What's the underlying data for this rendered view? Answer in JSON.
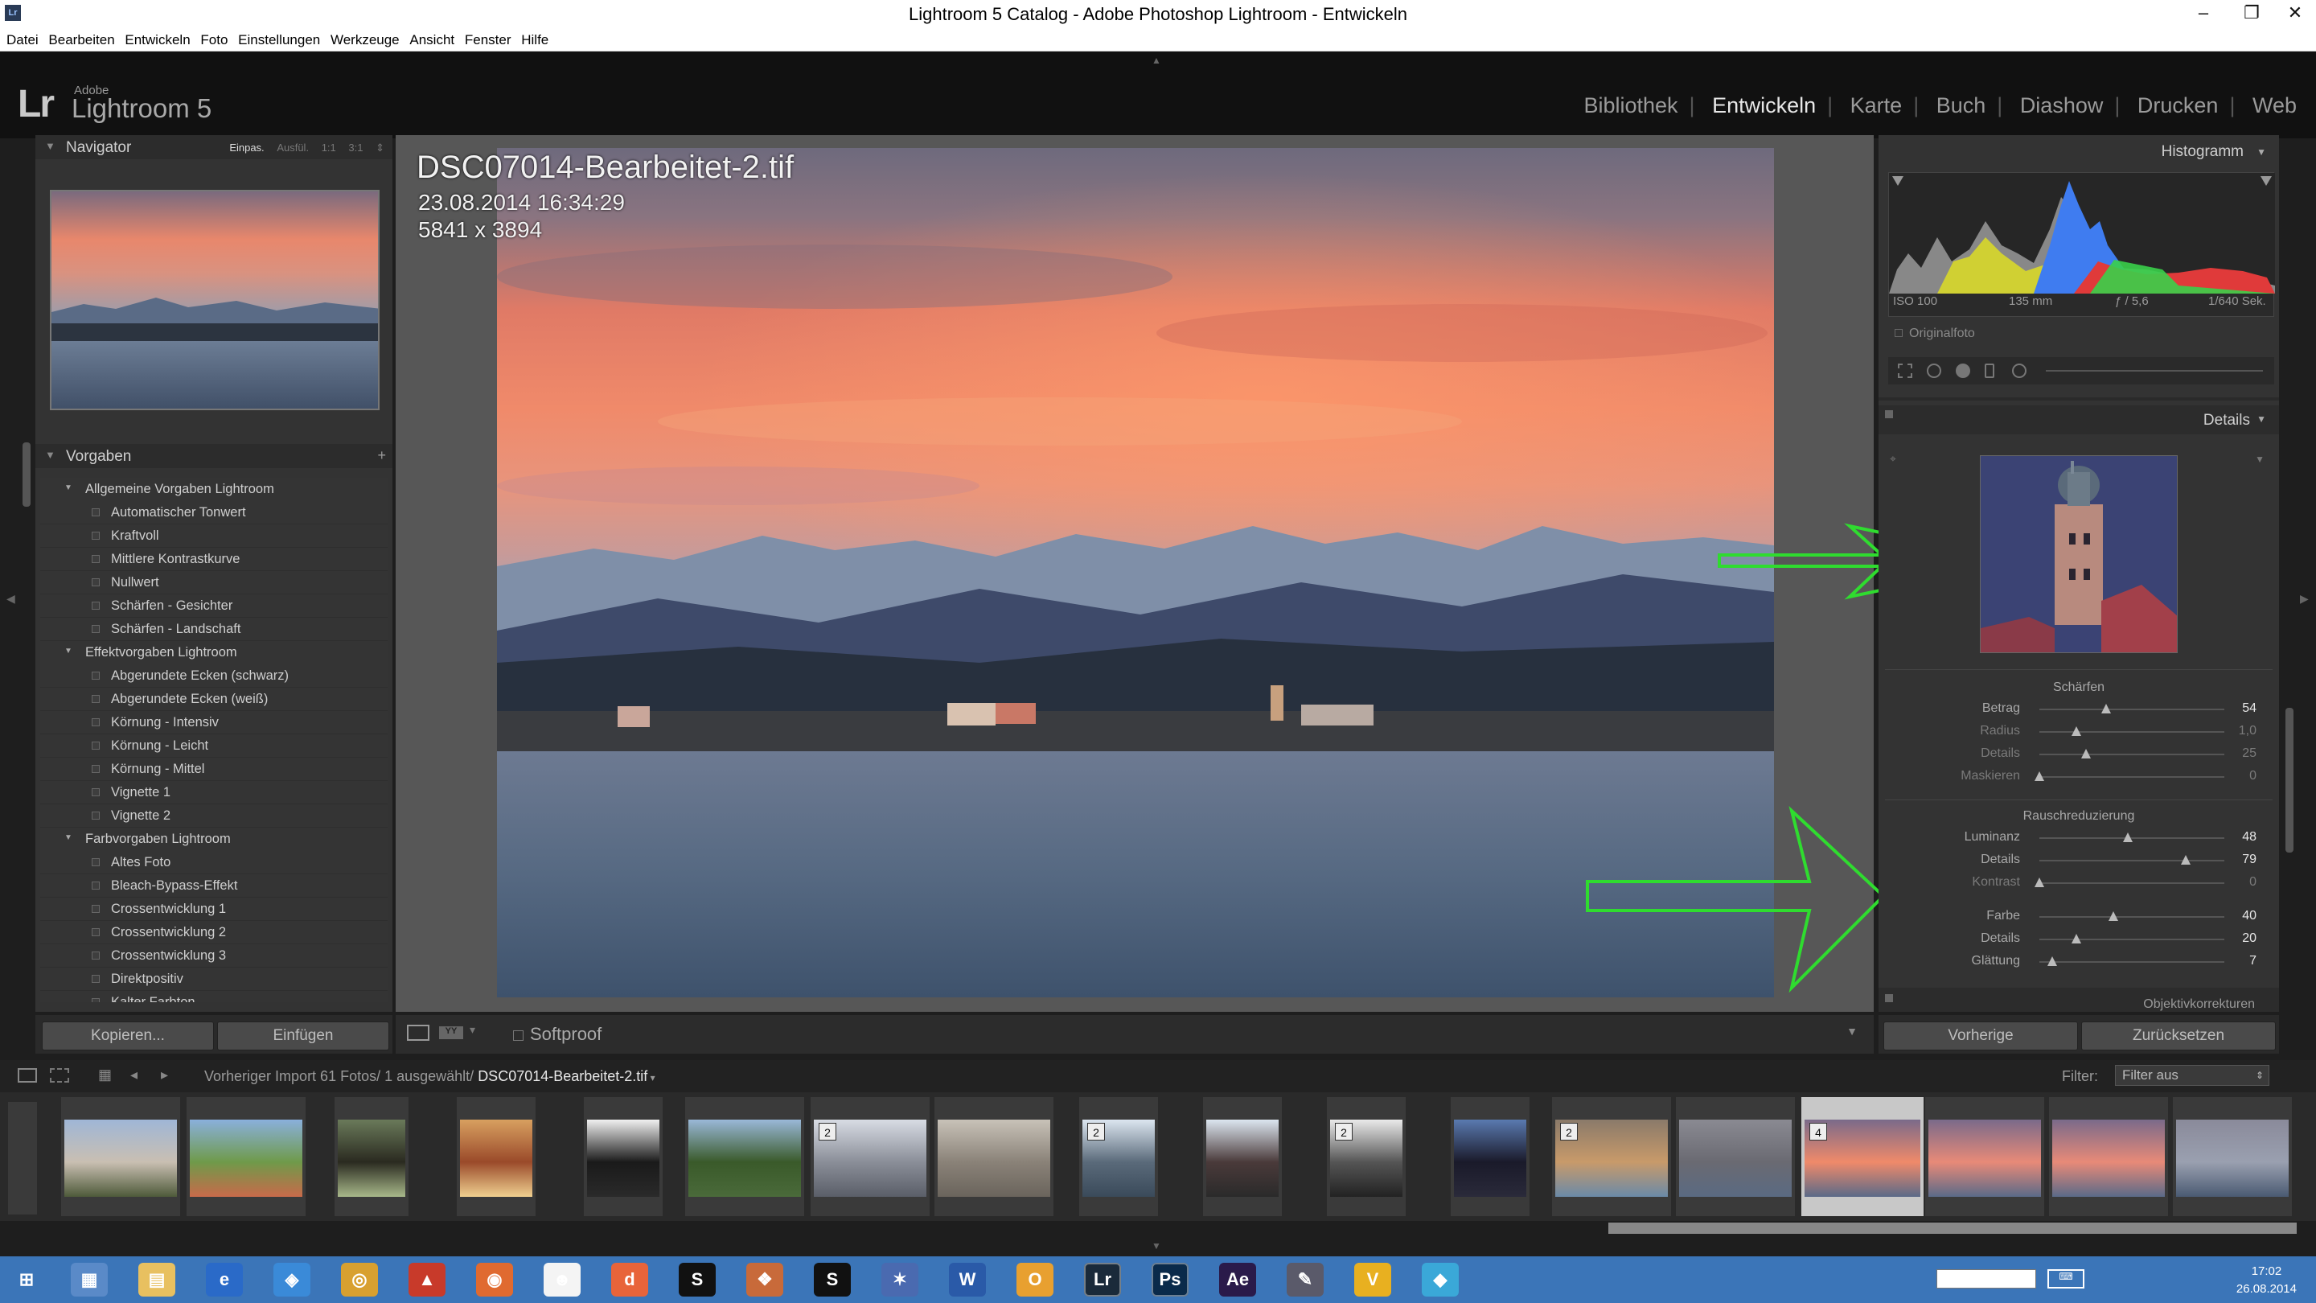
{
  "window": {
    "title": "Lightroom 5 Catalog - Adobe Photoshop Lightroom - Entwickeln",
    "minimize": "–",
    "maximize": "❐",
    "close": "✕"
  },
  "menu": [
    "Datei",
    "Bearbeiten",
    "Entwickeln",
    "Foto",
    "Einstellungen",
    "Werkzeuge",
    "Ansicht",
    "Fenster",
    "Hilfe"
  ],
  "identity": {
    "lr": "Lr",
    "adobe": "Adobe",
    "name": "Lightroom 5"
  },
  "modules": {
    "items": [
      "Bibliothek",
      "Entwickeln",
      "Karte",
      "Buch",
      "Diashow",
      "Drucken",
      "Web"
    ],
    "active": "Entwickeln"
  },
  "navigator": {
    "title": "Navigator",
    "zoom": [
      "Einpas.",
      "Ausfül.",
      "1:1",
      "3:1"
    ],
    "zoom_selected": "Einpas."
  },
  "presets": {
    "title": "Vorgaben",
    "add": "+",
    "items": [
      {
        "type": "folder",
        "label": "Allgemeine Vorgaben Lightroom"
      },
      {
        "type": "leaf",
        "label": "Automatischer Tonwert"
      },
      {
        "type": "leaf",
        "label": "Kraftvoll"
      },
      {
        "type": "leaf",
        "label": "Mittlere Kontrastkurve"
      },
      {
        "type": "leaf",
        "label": "Nullwert"
      },
      {
        "type": "leaf",
        "label": "Schärfen - Gesichter"
      },
      {
        "type": "leaf",
        "label": "Schärfen - Landschaft"
      },
      {
        "type": "folder",
        "label": "Effektvorgaben Lightroom"
      },
      {
        "type": "leaf",
        "label": "Abgerundete Ecken (schwarz)"
      },
      {
        "type": "leaf",
        "label": "Abgerundete Ecken (weiß)"
      },
      {
        "type": "leaf",
        "label": "Körnung - Intensiv"
      },
      {
        "type": "leaf",
        "label": "Körnung - Leicht"
      },
      {
        "type": "leaf",
        "label": "Körnung - Mittel"
      },
      {
        "type": "leaf",
        "label": "Vignette 1"
      },
      {
        "type": "leaf",
        "label": "Vignette 2"
      },
      {
        "type": "folder",
        "label": "Farbvorgaben Lightroom"
      },
      {
        "type": "leaf",
        "label": "Altes Foto"
      },
      {
        "type": "leaf",
        "label": "Bleach-Bypass-Effekt"
      },
      {
        "type": "leaf",
        "label": "Crossentwicklung 1"
      },
      {
        "type": "leaf",
        "label": "Crossentwicklung 2"
      },
      {
        "type": "leaf",
        "label": "Crossentwicklung 3"
      },
      {
        "type": "leaf",
        "label": "Direktpositiv"
      },
      {
        "type": "leaf",
        "label": "Kalter Farbton"
      }
    ]
  },
  "left_buttons": {
    "copy": "Kopieren...",
    "paste": "Einfügen"
  },
  "photo_info": {
    "filename": "DSC07014-Bearbeitet-2.tif",
    "datetime": "23.08.2014 16:34:29",
    "dimensions": "5841 x 3894"
  },
  "toolbar": {
    "softproof": "Softproof"
  },
  "histogram": {
    "title": "Histogramm",
    "iso": "ISO 100",
    "focal": "135 mm",
    "aperture": "ƒ / 5,6",
    "shutter": "1/640 Sek.",
    "original": "Originalfoto"
  },
  "details": {
    "title": "Details",
    "sharpen": {
      "title": "Schärfen",
      "rows": [
        {
          "label": "Betrag",
          "value": "54",
          "active": true
        },
        {
          "label": "Radius",
          "value": "1,0",
          "active": false
        },
        {
          "label": "Details",
          "value": "25",
          "active": false
        },
        {
          "label": "Maskieren",
          "value": "0",
          "active": false
        }
      ]
    },
    "noise": {
      "title": "Rauschreduzierung",
      "rows": [
        {
          "label": "Luminanz",
          "value": "48",
          "active": true
        },
        {
          "label": "Details",
          "value": "79",
          "active": true
        },
        {
          "label": "Kontrast",
          "value": "0",
          "active": false
        },
        {
          "label": "Farbe",
          "value": "40",
          "active": true
        },
        {
          "label": "Details",
          "value": "20",
          "active": true
        },
        {
          "label": "Glättung",
          "value": "7",
          "active": true
        }
      ]
    },
    "next_panel": "Objektivkorrekturen"
  },
  "right_buttons": {
    "previous": "Vorherige",
    "reset": "Zurücksetzen"
  },
  "filmstrip": {
    "source_prefix": "Vorheriger Import   61 Fotos/ 1 ausgewählt/ ",
    "source_file": "DSC07014-Bearbeitet-2.tif",
    "filter_label": "Filter:",
    "filter_value": "Filter aus",
    "stack_badges": [
      "2",
      "2",
      "2",
      "2",
      "4"
    ]
  },
  "taskbar": {
    "time": "17:02",
    "date": "26.08.2014"
  }
}
